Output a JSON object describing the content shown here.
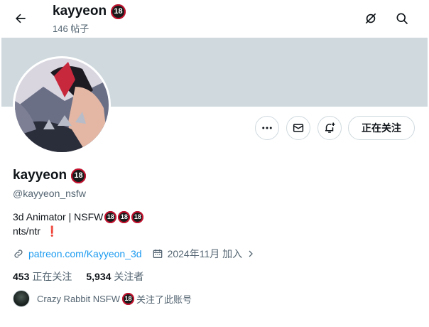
{
  "header": {
    "title": "kayyeon",
    "title_badge": "18",
    "subtitle": "146 帖子"
  },
  "profile": {
    "name": "kayyeon",
    "name_badge": "18",
    "handle": "@kayyeon_nsfw",
    "bio_line1": "3d Animator | NSFW",
    "bio_badges": [
      "18",
      "18",
      "18"
    ],
    "bio_line2": "nts/ntr",
    "bio_line2_emoji": "❗",
    "link": "patreon.com/Kayyeon_3d",
    "joined": "2024年11月 加入"
  },
  "actions": {
    "follow_label": "正在关注"
  },
  "stats": {
    "following_count": "453",
    "following_label": "正在关注",
    "followers_count": "5,934",
    "followers_label": "关注者"
  },
  "followed_by": {
    "name": "Crazy Rabbit NSFW",
    "badge": "18",
    "text": "关注了此账号"
  },
  "colors": {
    "banner": "#cfd9de",
    "link": "#1d9bf0",
    "muted": "#536471"
  }
}
